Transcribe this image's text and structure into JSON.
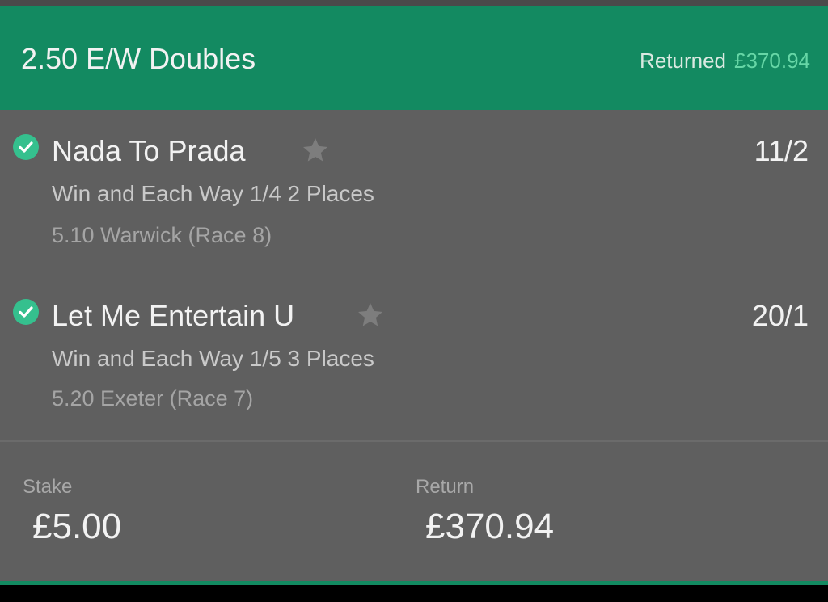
{
  "header": {
    "bet_type": "2.50 E/W Doubles",
    "returned_label": "Returned",
    "returned_amount": "£370.94"
  },
  "selections": [
    {
      "name": "Nada To Prada",
      "odds": "11/2",
      "market": "Win and Each Way 1/4 2 Places",
      "event": "5.10 Warwick (Race 8)",
      "status_icon": "check-circle-icon",
      "favourite_icon": "star-icon"
    },
    {
      "name": "Let Me Entertain U",
      "odds": "20/1",
      "market": "Win and Each Way 1/5 3 Places",
      "event": "5.20 Exeter (Race 7)",
      "status_icon": "check-circle-icon",
      "favourite_icon": "star-icon"
    }
  ],
  "footer": {
    "stake_label": "Stake",
    "stake_value": "£5.00",
    "return_label": "Return",
    "return_value": "£370.94"
  },
  "colors": {
    "brand_green": "#138a61",
    "check_green": "#35c08e",
    "background": "#5f5f5f",
    "returned_amount": "#66d6a6"
  }
}
